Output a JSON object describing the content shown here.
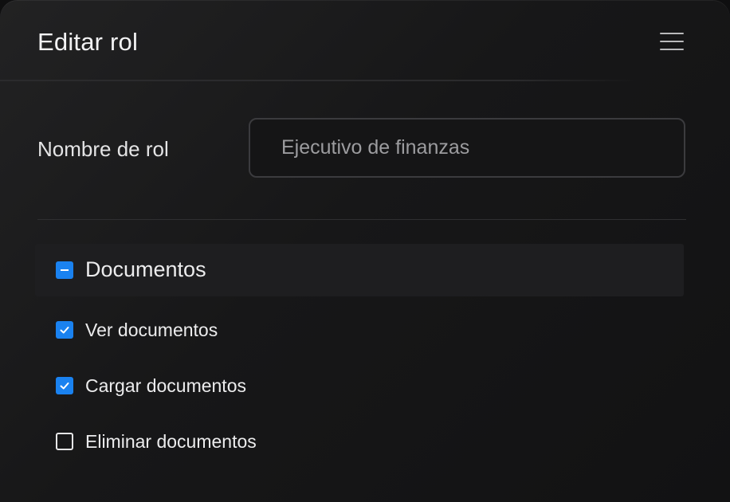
{
  "header": {
    "title": "Editar rol",
    "menu_icon": "menu-icon"
  },
  "form": {
    "role_name_label": "Nombre de rol",
    "role_name_value": "Ejecutivo de finanzas"
  },
  "permissions": {
    "group": {
      "label": "Documentos",
      "state": "indeterminate"
    },
    "items": [
      {
        "label": "Ver documentos",
        "checked": true
      },
      {
        "label": "Cargar documentos",
        "checked": true
      },
      {
        "label": "Eliminar documentos",
        "checked": false
      }
    ]
  },
  "colors": {
    "accent": "#1a82f0",
    "background": "#161617",
    "text": "#ececed"
  }
}
